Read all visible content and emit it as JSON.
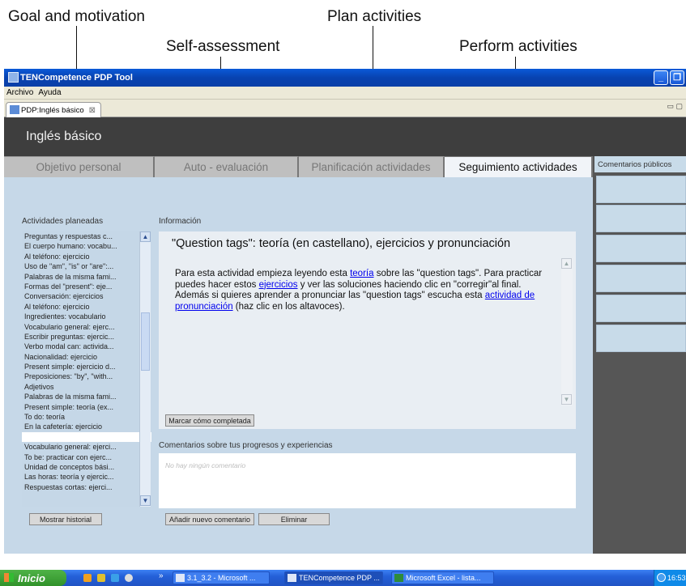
{
  "annotations": {
    "goal": "Goal and motivation",
    "self": "Self-assessment",
    "plan": "Plan activities",
    "perform": "Perform activities"
  },
  "window": {
    "title": "TENCompetence PDP Tool",
    "menu": [
      "Archivo",
      "Ayuda"
    ],
    "doc_tab": "PDP:Inglés básico"
  },
  "banner": {
    "title": "Inglés básico"
  },
  "tabs": [
    "Objetivo personal",
    "Auto - evaluación",
    "Planificación actividades",
    "Seguimiento actividades"
  ],
  "right_pane": {
    "header": "Comentarios públicos"
  },
  "activities": {
    "label": "Actividades planeadas",
    "items": [
      "Preguntas y respuestas c...",
      "El cuerpo humano: vocabu...",
      "Al teléfono: ejercicio",
      "Uso de \"am\", \"is\" or \"are\":...",
      "Palabras de la misma fami...",
      "Formas del \"present\": eje...",
      "Conversación: ejercicios",
      "Al teléfono: ejercicio",
      "Ingredientes: vocabulario",
      "Vocabulario general: ejerc...",
      "Escribir preguntas: ejercic...",
      "Verbo modal can: activida...",
      "Nacionalidad: ejercicio",
      "Present simple: ejercicio d...",
      "Preposiciones: \"by\", \"with...",
      "Adjetivos",
      "Palabras de la misma fami...",
      "Present simple: teoría (ex...",
      "To do: teoría",
      "En la cafetería: ejercicio",
      "",
      "Vocabulario general: ejerci...",
      "To be: practicar con ejerc...",
      "Unidad de conceptos bási...",
      "Las horas: teoría y ejercic...",
      "Respuestas cortas: ejerci..."
    ],
    "history_button": "Mostrar historial"
  },
  "info": {
    "label": "Información",
    "title": "\"Question tags\": teoría (en castellano), ejercicios y pronunciación",
    "text_1": "Para esta actividad empieza leyendo esta ",
    "link_1": "teoría",
    "text_2": " sobre las \"question tags\". Para practicar puedes hacer estos ",
    "link_2": "ejercicios",
    "text_3": " y ver las soluciones haciendo clic en \"corregir\"al final. Además si quieres aprender a pronunciar las \"question tags\" escucha esta ",
    "link_3": "actividad de pronunciación",
    "text_4": " (haz clic en los altavoces).",
    "complete_button": "Marcar cómo completada"
  },
  "comments": {
    "label": "Comentarios sobre tus progresos y experiencias",
    "empty": "No hay ningún comentario",
    "add_button": "Añadir nuevo comentario",
    "delete_button": "Eliminar"
  },
  "taskbar": {
    "start": "Inicio",
    "tasks": [
      "3.1_3.2 - Microsoft ...",
      "TENCompetence PDP ...",
      "Microsoft Excel - lista..."
    ],
    "clock": "16:53",
    "overflow": "»"
  }
}
